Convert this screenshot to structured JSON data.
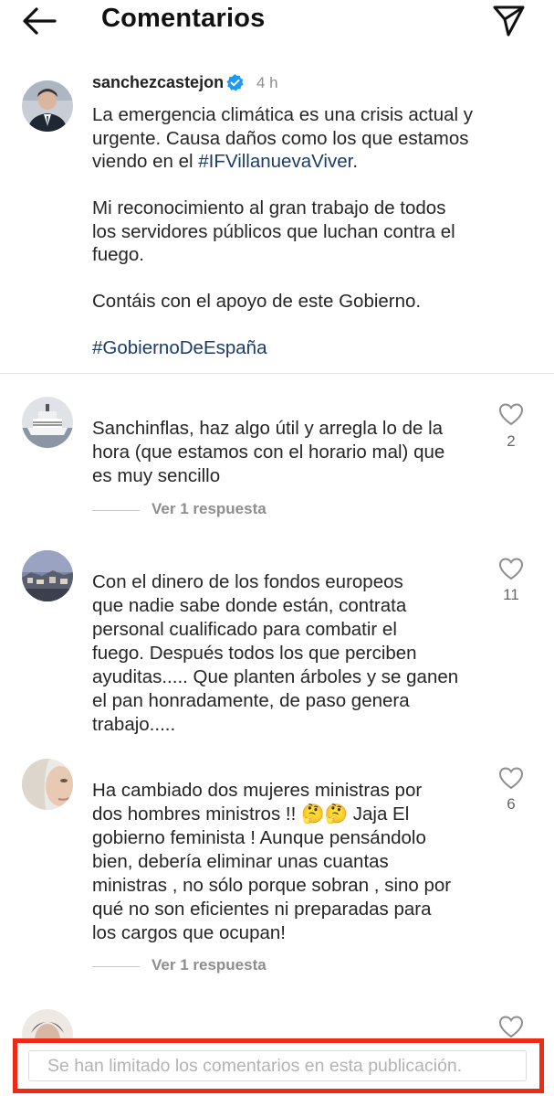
{
  "header": {
    "back_icon": "arrow-left-icon",
    "title": "Comentarios",
    "send_icon": "paper-plane-icon"
  },
  "caption": {
    "username": "sanchezcastejon",
    "verified_icon": "verified-badge-icon",
    "time": "4 h",
    "line1": "La emergencia climática es una crisis actual y",
    "line2": "urgente. Causa daños como los que estamos",
    "line3_pre": "viendo en el ",
    "line3_tag": "#IFVillanuevaViver",
    "line3_post": ".",
    "line4": "Mi reconocimiento al gran trabajo de todos",
    "line5": "los servidores públicos que luchan contra el",
    "line6": "fuego.",
    "line7": "Contáis con el apoyo de este Gobierno.",
    "hashtag2": "#GobiernoDeEspaña"
  },
  "comments": [
    {
      "lines": [
        "Sanchinflas, haz algo útil y arregla lo de la",
        "hora (que estamos con el horario mal) que",
        "es muy sencillo"
      ],
      "likes": "2",
      "replies_label": "Ver 1 respuesta"
    },
    {
      "lines": [
        "Con el dinero de los fondos europeos",
        "que nadie sabe donde están, contrata",
        "personal cualificado para combatir el",
        "fuego. Después todos los que perciben",
        "ayuditas..... Que planten árboles y se ganen",
        "el pan honradamente, de paso genera",
        "trabajo....."
      ],
      "likes": "11"
    },
    {
      "lines": [
        "Ha cambiado dos mujeres ministras  por",
        "dos hombres ministros !! 🤔🤔 Jaja El",
        "gobierno feminista ! Aunque pensándolo",
        "bien, debería eliminar unas cuantas",
        "ministras , no sólo porque sobran , sino por",
        "qué no son eficientes ni preparadas para",
        "los cargos que ocupan!"
      ],
      "likes": "6",
      "replies_label": "Ver 1 respuesta"
    }
  ],
  "footer": {
    "limited_text": "Se han limitado los comentarios en esta publicación.",
    "highlight_color": "#ee2a14"
  },
  "colors": {
    "hashtag": "#1b3c6b",
    "verified": "#1d9bf0"
  }
}
